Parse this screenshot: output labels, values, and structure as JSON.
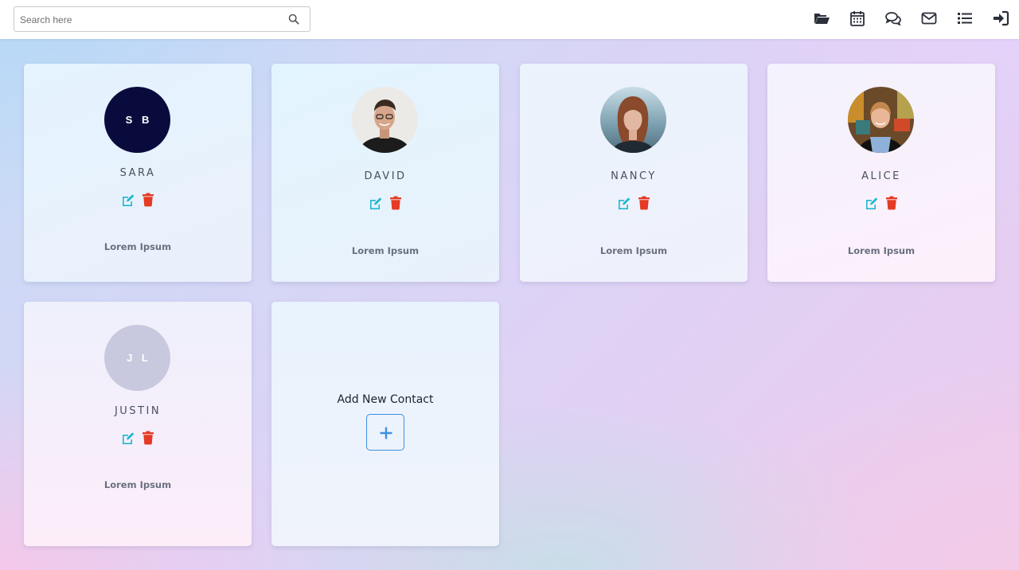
{
  "search": {
    "placeholder": "Search here",
    "value": ""
  },
  "nav_icons": [
    "folder-open-icon",
    "calendar-icon",
    "comments-icon",
    "envelope-icon",
    "list-icon",
    "sign-in-icon"
  ],
  "colors": {
    "edit": "#1fb8cf",
    "delete": "#e53a23",
    "add_accent": "#3d8fe0"
  },
  "contacts": [
    {
      "name": "SARA",
      "initials": "S B",
      "avatar": "initials",
      "description": "Lorem Ipsum"
    },
    {
      "name": "DAVID",
      "avatar": "photo-man-glasses",
      "description": "Lorem Ipsum"
    },
    {
      "name": "NANCY",
      "avatar": "photo-woman-redhair",
      "description": "Lorem Ipsum"
    },
    {
      "name": "ALICE",
      "avatar": "photo-woman-apron",
      "description": "Lorem Ipsum"
    },
    {
      "name": "JUSTIN",
      "initials": "J L",
      "avatar": "initials",
      "description": "Lorem Ipsum"
    }
  ],
  "add_card": {
    "label": "Add New Contact"
  }
}
